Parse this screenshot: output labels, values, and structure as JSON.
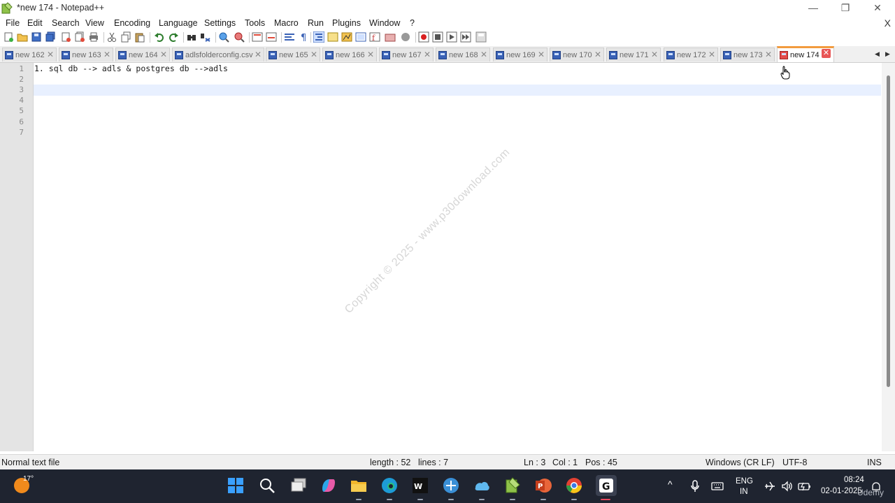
{
  "window": {
    "title": "*new 174 - Notepad++",
    "minimize_glyph": "—",
    "restore_glyph": "❐",
    "close_glyph": "✕"
  },
  "menu": {
    "items": [
      "File",
      "Edit",
      "Search",
      "View",
      "Encoding",
      "Language",
      "Settings",
      "Tools",
      "Macro",
      "Run",
      "Plugins",
      "Window",
      "?"
    ],
    "close_glyph": "X"
  },
  "tabs": [
    {
      "label": "new 162",
      "active": false
    },
    {
      "label": "new 163",
      "active": false
    },
    {
      "label": "new 164",
      "active": false
    },
    {
      "label": "adlsfolderconfig.csv",
      "active": false
    },
    {
      "label": "new 165",
      "active": false
    },
    {
      "label": "new 166",
      "active": false
    },
    {
      "label": "new 167",
      "active": false
    },
    {
      "label": "new 168",
      "active": false
    },
    {
      "label": "new 169",
      "active": false
    },
    {
      "label": "new 170",
      "active": false
    },
    {
      "label": "new 171",
      "active": false
    },
    {
      "label": "new 172",
      "active": false
    },
    {
      "label": "new 173",
      "active": false
    },
    {
      "label": "new 174",
      "active": true
    }
  ],
  "tab_close_glyph": "✕",
  "editor": {
    "line_numbers": [
      "1",
      "2",
      "3",
      "4",
      "5",
      "6",
      "7"
    ],
    "lines": [
      "1. sql db --> adls & postgres db -->adls",
      "",
      "",
      "",
      "",
      "",
      ""
    ],
    "current_line": 3
  },
  "watermark": "Copyright © 2025 - www.p30download.com",
  "status": {
    "file_type": "Normal text file",
    "length": "length : 52",
    "lines": "lines : 7",
    "ln": "Ln : 3",
    "col": "Col : 1",
    "pos": "Pos : 45",
    "eol": "Windows (CR LF)",
    "encoding": "UTF-8",
    "mode": "INS"
  },
  "taskbar": {
    "temperature": "17°",
    "lang_top": "ENG",
    "lang_bottom": "IN",
    "time": "08:24",
    "date": "02-01-2025",
    "overlay": "Udemy",
    "chevron": "^"
  },
  "colors": {
    "active_tab_accent": "#f29b3e",
    "current_line": "#e8f0ff",
    "taskbar_bg": "#1f2430"
  }
}
